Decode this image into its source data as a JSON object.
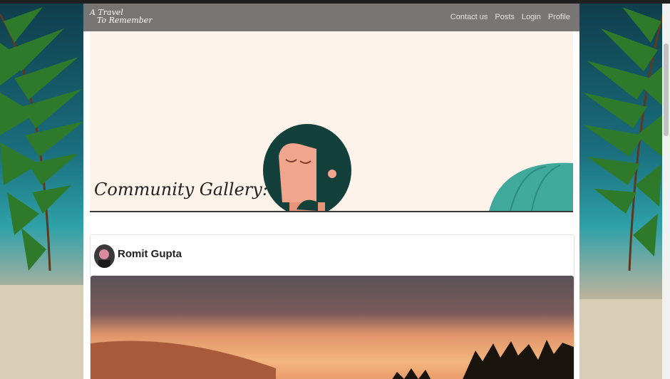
{
  "brand": {
    "line1": "A Travel",
    "line2": "To Remember"
  },
  "nav": {
    "items": [
      {
        "label": "Contact us"
      },
      {
        "label": "Posts"
      },
      {
        "label": "Login"
      },
      {
        "label": "Profile"
      }
    ]
  },
  "hero": {
    "title": "Community Gallery:"
  },
  "post": {
    "author": "Romit Gupta"
  },
  "colors": {
    "navbar": "#5a5856",
    "hero_bg": "#fdf3ea",
    "umbrella": "#3fa99b",
    "hair": "#14403c",
    "skin": "#f0a58c"
  }
}
